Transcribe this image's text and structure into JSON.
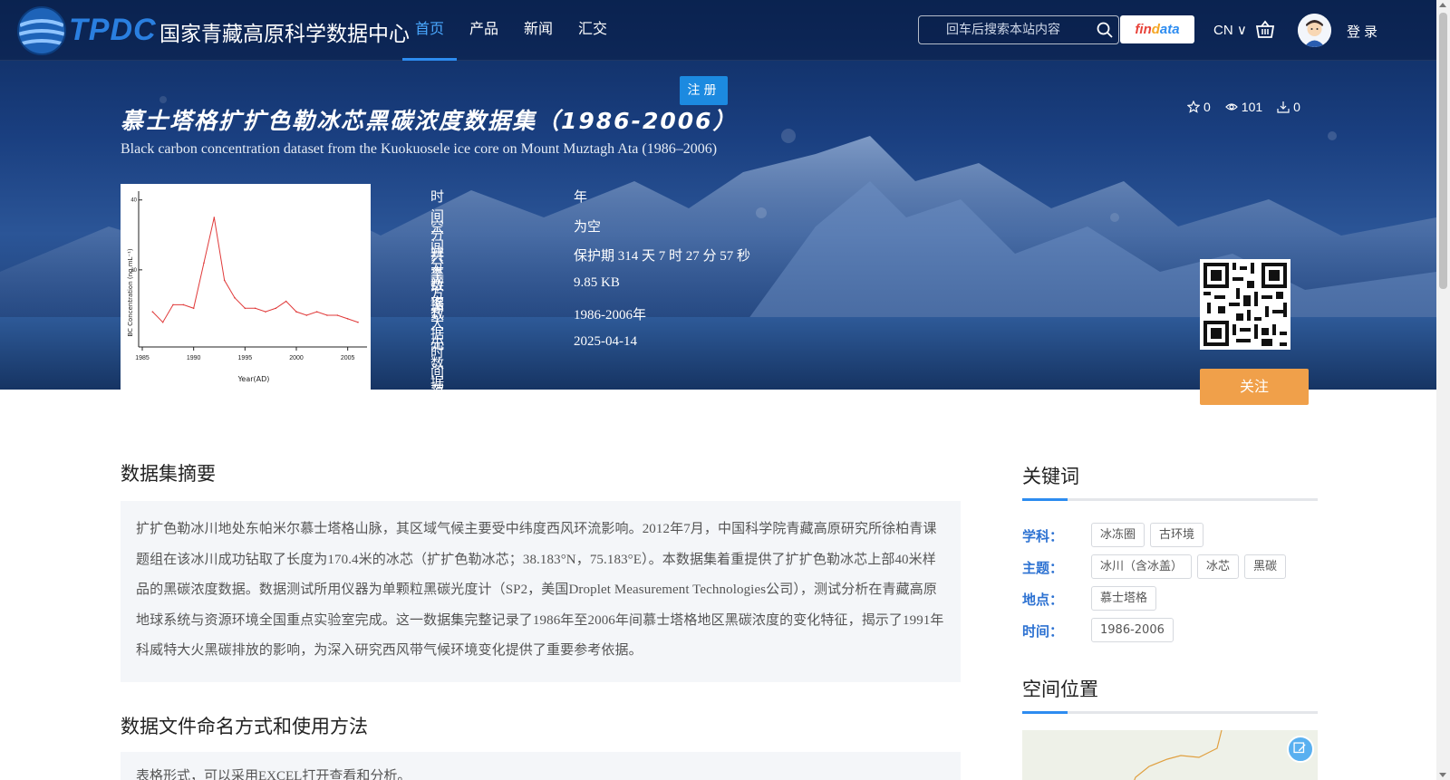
{
  "nav": {
    "logo_text": "TPDC",
    "logo_cn": "国家青藏高原科学数据中心",
    "menu": [
      {
        "label": "首页",
        "active": true
      },
      {
        "label": "产品",
        "active": false
      },
      {
        "label": "新闻",
        "active": false
      },
      {
        "label": "汇交",
        "active": false
      }
    ],
    "search_placeholder": "回车后搜索本站内容",
    "findata": {
      "p1": "fin",
      "p2": "d",
      "p3": "ata"
    },
    "lang": "CN",
    "login": "登录"
  },
  "hero": {
    "register": "注册",
    "title": "慕士塔格扩扩色勒冰芯黑碳浓度数据集（1986-2006）",
    "subtitle": "Black carbon concentration dataset from the Kuokuosele ice core on Mount Muztagh Ata (1986–2006)",
    "stats": {
      "favorites": "0",
      "views": "101",
      "downloads": "0"
    },
    "meta": [
      {
        "label": "时间分辨率",
        "value": "年"
      },
      {
        "label": "空间分辨率",
        "value": "为空"
      },
      {
        "label": "共享方式",
        "value": "保护期 314 天 7 时 27 分 57 秒"
      },
      {
        "label": "数据大小",
        "value": "9.85 KB"
      },
      {
        "label": "数据时间范围",
        "value": "1986-2006年"
      },
      {
        "label": "元数据更新时间",
        "value": "2025-04-14"
      }
    ],
    "follow": "关注"
  },
  "thumbnail": {
    "ylabel": "BC Concentration (ng mL⁻¹)",
    "xlabel": "Year(AD)",
    "x_ticks": [
      "1985",
      "1990",
      "1995",
      "2000",
      "2005"
    ],
    "y_ticks": [
      "40",
      "20"
    ]
  },
  "chart_data": {
    "type": "line",
    "x": [
      1986,
      1987,
      1988,
      1989,
      1990,
      1991,
      1992,
      1993,
      1994,
      1995,
      1996,
      1997,
      1998,
      1999,
      2000,
      2001,
      2002,
      2003,
      2004,
      2005,
      2006
    ],
    "values": [
      8,
      5,
      10,
      10,
      9,
      22,
      35,
      17,
      12,
      9,
      9,
      8,
      9,
      11,
      8,
      7,
      8,
      7,
      7,
      6,
      5
    ],
    "xlabel": "Year(AD)",
    "ylabel": "BC Concentration (ng mL⁻¹)",
    "ylim": [
      0,
      42
    ],
    "xlim": [
      1985,
      2006
    ]
  },
  "main": {
    "abstract_title": "数据集摘要",
    "abstract": "扩扩色勒冰川地处东帕米尔慕士塔格山脉，其区域气候主要受中纬度西风环流影响。2012年7月，中国科学院青藏高原研究所徐柏青课题组在该冰川成功钻取了长度为170.4米的冰芯（扩扩色勒冰芯；38.183°N，75.183°E）。本数据集着重提供了扩扩色勒冰芯上部40米样品的黑碳浓度数据。数据测试所用仪器为单颗粒黑碳光度计（SP2，美国Droplet Measurement Technologies公司），测试分析在青藏高原地球系统与资源环境全国重点实验室完成。这一数据集完整记录了1986年至2006年间慕士塔格地区黑碳浓度的变化特征，揭示了1991年科威特大火黑碳排放的影响，为深入研究西风带气候环境变化提供了重要参考依据。",
    "usage_title": "数据文件命名方式和使用方法",
    "usage": "表格形式，可以采用EXCEL打开查看和分析。"
  },
  "sidebar": {
    "keywords_title": "关键词",
    "keywords": [
      {
        "label": "学科：",
        "tags": [
          "冰冻圈",
          "古环境"
        ]
      },
      {
        "label": "主题：",
        "tags": [
          "冰川（含冰盖）",
          "冰芯",
          "黑碳"
        ]
      },
      {
        "label": "地点：",
        "tags": [
          "慕士塔格"
        ]
      },
      {
        "label": "时间：",
        "tags": [
          "1986-2006"
        ]
      }
    ],
    "location_title": "空间位置"
  },
  "colors": {
    "accent": "#2d8cf0",
    "follow": "#f0a04a",
    "register": "#1c8ae0"
  }
}
